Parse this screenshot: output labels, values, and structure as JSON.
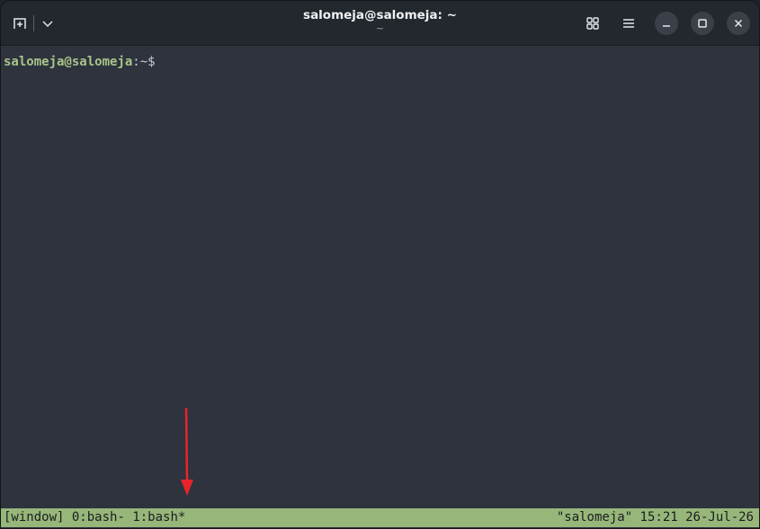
{
  "window": {
    "title": "salomeja@salomeja: ~",
    "subtitle": "~"
  },
  "header": {
    "left_icons": [
      "new-tab-icon",
      "chevron-down-icon"
    ],
    "right_icons": [
      "grid-icon",
      "hamburger-menu-icon",
      "minimize-icon",
      "maximize-icon",
      "close-icon"
    ]
  },
  "terminal": {
    "prompt_user": "salomeja@salomeja",
    "prompt_sep": ":",
    "prompt_path": "~",
    "prompt_symbol": "$"
  },
  "tmux_status": {
    "session": "[window]",
    "windows": " 0:bash- 1:bash*",
    "right": "\"salomeja\" 15:21 26-Jul-26"
  },
  "colors": {
    "terminal_bg": "#2e333d",
    "titlebar_bg": "#23272e",
    "status_bg": "#97b77a",
    "prompt_user": "#a8c48a",
    "arrow": "#e8242a"
  }
}
